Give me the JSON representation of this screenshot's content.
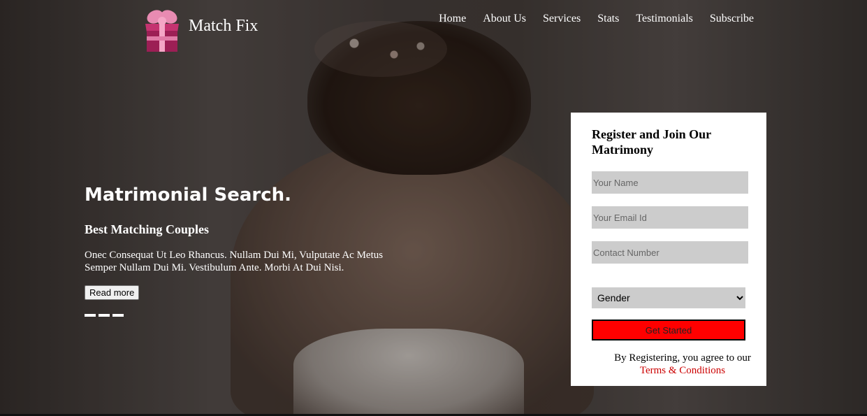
{
  "brand": {
    "name": "Match Fix",
    "logo_icon": "gift-box-icon",
    "logo_color": "#b0245e"
  },
  "nav": {
    "items": [
      {
        "label": "Home"
      },
      {
        "label": "About Us"
      },
      {
        "label": "Services"
      },
      {
        "label": "Stats"
      },
      {
        "label": "Testimonials"
      },
      {
        "label": "Subscribe"
      }
    ]
  },
  "hero": {
    "title": "Matrimonial Search.",
    "subtitle": "Best Matching Couples",
    "text": "Onec Consequat Ut Leo Rhancus. Nullam Dui Mi, Vulputate Ac Metus Semper Nullam Dui Mi. Vestibulum Ante. Morbi At Dui Nisi.",
    "button_label": "Read more"
  },
  "form": {
    "title": "Register and Join Our Matrimony",
    "name_placeholder": "Your Name",
    "email_placeholder": "Your Email Id",
    "contact_placeholder": "Contact Number",
    "gender_label": "Gender",
    "submit_label": "Get Started",
    "terms_prefix": "By Registering, you agree to our",
    "terms_link": "Terms & Conditions",
    "accent_color": "#ff0000"
  }
}
